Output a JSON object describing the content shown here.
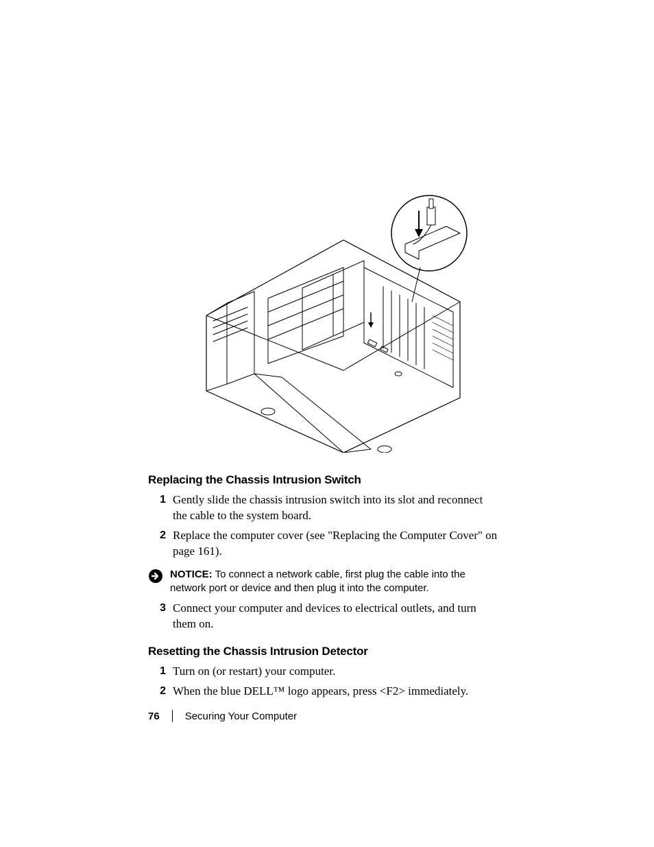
{
  "sections": {
    "replacing": {
      "heading": "Replacing the Chassis Intrusion Switch",
      "steps": [
        {
          "num": "1",
          "text": "Gently slide the chassis intrusion switch into its slot and reconnect the cable to the system board."
        },
        {
          "num": "2",
          "text": "Replace the computer cover (see \"Replacing the Computer Cover\" on page 161)."
        },
        {
          "num": "3",
          "text": "Connect your computer and devices to electrical outlets, and turn them on."
        }
      ]
    },
    "resetting": {
      "heading": "Resetting the Chassis Intrusion Detector",
      "steps": [
        {
          "num": "1",
          "text": "Turn on (or restart) your computer."
        },
        {
          "num": "2",
          "text": "When the blue DELL™ logo appears, press <F2> immediately."
        }
      ]
    }
  },
  "notice": {
    "label": "NOTICE:",
    "text": " To connect a network cable, first plug the cable into the network port or device and then plug it into the computer."
  },
  "footer": {
    "page_number": "76",
    "section_title": "Securing Your Computer"
  }
}
